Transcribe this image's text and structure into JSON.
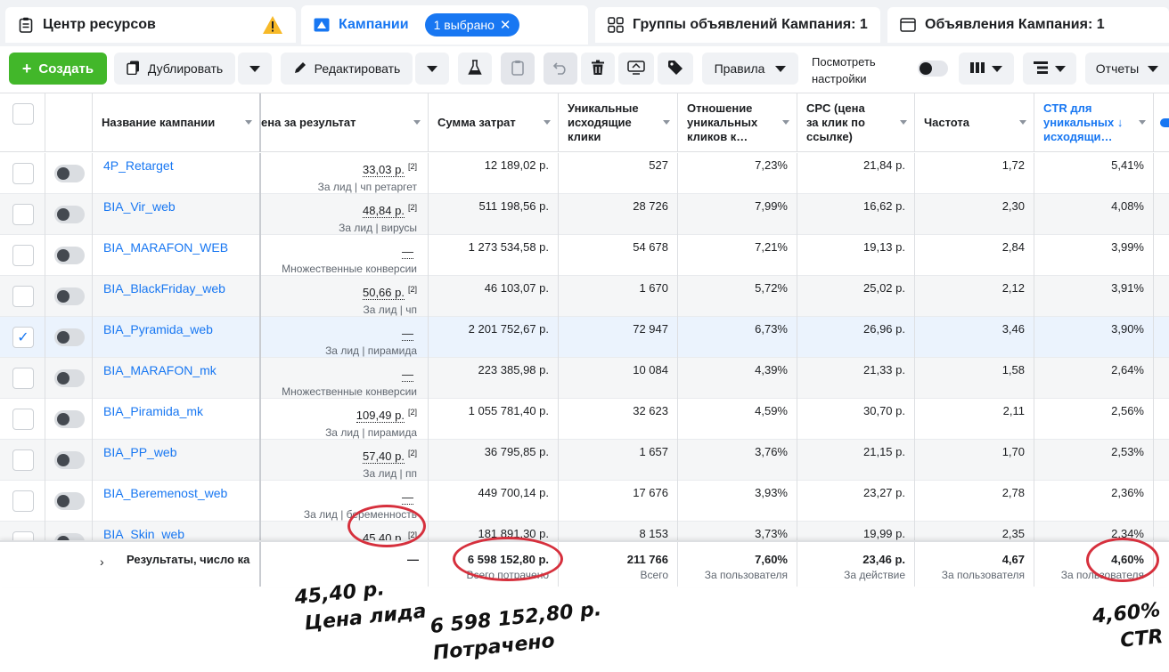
{
  "tabs": [
    {
      "label": "Центр ресурсов",
      "warning": true
    },
    {
      "label": "Кампании",
      "pill": "1 выбрано"
    },
    {
      "label": "Группы объявлений Кампания: 1"
    },
    {
      "label": "Объявления Кампания: 1"
    }
  ],
  "toolbar": {
    "create": "Создать",
    "duplicate": "Дублировать",
    "edit": "Редактировать",
    "rules": "Правила",
    "view_settings_1": "Посмотреть",
    "view_settings_2": "настройки",
    "reports": "Отчеты"
  },
  "columns": {
    "name": "Название кампании",
    "result_cost": "ена за результат",
    "spend": "Сумма затрат",
    "uclicks_1": "Уникальные",
    "uclicks_2": "исходящие",
    "uclicks_3": "клики",
    "ratio_1": "Отношение",
    "ratio_2": "уникальных",
    "ratio_3": "кликов к…",
    "cpc_1": "CPC (цена",
    "cpc_2": "за клик по",
    "cpc_3": "ссылке)",
    "freq": "Частота",
    "ctr_1": "CTR для",
    "ctr_2": "уникальных ↓",
    "ctr_3": "исходящи…"
  },
  "rows": [
    {
      "name": "4P_Retarget",
      "cost": "33,03 р.",
      "ref": "[2]",
      "sub": "За лид | чп ретаргет",
      "spend": "12 189,02 р.",
      "uclicks": "527",
      "ratio": "7,23%",
      "cpc": "21,84 р.",
      "freq": "1,72",
      "ctr": "5,41%"
    },
    {
      "name": "BIA_Vir_web",
      "cost": "48,84 р.",
      "ref": "[2]",
      "sub": "За лид | вирусы",
      "spend": "511 198,56 р.",
      "uclicks": "28 726",
      "ratio": "7,99%",
      "cpc": "16,62 р.",
      "freq": "2,30",
      "ctr": "4,08%"
    },
    {
      "name": "BIA_MARAFON_WEB",
      "cost": "—",
      "ref": "",
      "sub": "Множественные конверсии",
      "spend": "1 273 534,58 р.",
      "uclicks": "54 678",
      "ratio": "7,21%",
      "cpc": "19,13 р.",
      "freq": "2,84",
      "ctr": "3,99%"
    },
    {
      "name": "BIA_BlackFriday_web",
      "cost": "50,66 р.",
      "ref": "[2]",
      "sub": "За лид | чп",
      "spend": "46 103,07 р.",
      "uclicks": "1 670",
      "ratio": "5,72%",
      "cpc": "25,02 р.",
      "freq": "2,12",
      "ctr": "3,91%"
    },
    {
      "name": "BIA_Pyramida_web",
      "cost": "—",
      "ref": "",
      "sub": "За лид | пирамида",
      "spend": "2 201 752,67 р.",
      "uclicks": "72 947",
      "ratio": "6,73%",
      "cpc": "26,96 р.",
      "freq": "3,46",
      "ctr": "3,90%",
      "selected": true
    },
    {
      "name": "BIA_MARAFON_mk",
      "cost": "—",
      "ref": "",
      "sub": "Множественные конверсии",
      "spend": "223 385,98 р.",
      "uclicks": "10 084",
      "ratio": "4,39%",
      "cpc": "21,33 р.",
      "freq": "1,58",
      "ctr": "2,64%"
    },
    {
      "name": "BIA_Piramida_mk",
      "cost": "109,49 р.",
      "ref": "[2]",
      "sub": "За лид | пирамида",
      "spend": "1 055 781,40 р.",
      "uclicks": "32 623",
      "ratio": "4,59%",
      "cpc": "30,70 р.",
      "freq": "2,11",
      "ctr": "2,56%"
    },
    {
      "name": "BIA_PP_web",
      "cost": "57,40 р.",
      "ref": "[2]",
      "sub": "За лид | пп",
      "spend": "36 795,85 р.",
      "uclicks": "1 657",
      "ratio": "3,76%",
      "cpc": "21,15 р.",
      "freq": "1,70",
      "ctr": "2,53%"
    },
    {
      "name": "BIA_Beremenost_web",
      "cost": "—",
      "ref": "",
      "sub": "За лид | беременность",
      "spend": "449 700,14 р.",
      "uclicks": "17 676",
      "ratio": "3,93%",
      "cpc": "23,27 р.",
      "freq": "2,78",
      "ctr": "2,36%"
    },
    {
      "name": "BIA_Skin_web",
      "cost": "45,40 р.",
      "ref": "[2]",
      "sub": "",
      "spend": "181 891,30 р.",
      "uclicks": "8 153",
      "ratio": "3,73%",
      "cpc": "19,99 р.",
      "freq": "2,35",
      "ctr": "2,34%"
    }
  ],
  "totals": {
    "label": "Результаты, число ка",
    "cost": "—",
    "spend": "6 598 152,80 р.",
    "spend_sub": "Всего потрачено",
    "uclicks": "211 766",
    "uclicks_sub": "Всего",
    "ratio": "7,60%",
    "ratio_sub": "За пользователя",
    "cpc": "23,46 р.",
    "cpc_sub": "За действие",
    "freq": "4,67",
    "freq_sub": "За пользователя",
    "ctr": "4,60%",
    "ctr_sub": "За пользователя"
  },
  "annotations": {
    "lead_price_1": "45,40 р.",
    "lead_price_2": "Цена лида",
    "spent_1": "6 598 152,80 р.",
    "spent_2": "Потрачено",
    "ctr_1": "4,60%",
    "ctr_2": "CTR"
  },
  "colors": {
    "accent": "#1877f2",
    "create": "#42b72a",
    "annotation": "#d6303d"
  }
}
